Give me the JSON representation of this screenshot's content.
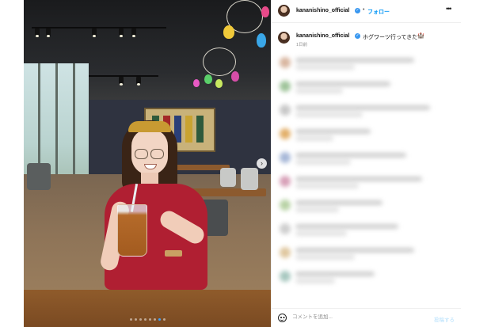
{
  "header": {
    "username": "kananishino_official",
    "verified_icon": "verified-badge-icon",
    "separator": "•",
    "follow_label": "フォロー",
    "more_icon": "more-options-icon",
    "more_glyph": "•••"
  },
  "caption": {
    "username": "kananishino_official",
    "text": "ホグワーツ行ってきた",
    "emoji": "🏰",
    "time": "1日前"
  },
  "media": {
    "next_icon": "chevron-right-icon",
    "next_glyph": "›",
    "carousel_count": 8,
    "carousel_active_index": 6,
    "colors": {
      "active_dot": "#3aa3ff",
      "shirt": "#b01f32"
    }
  },
  "comment_box": {
    "emoji_icon": "emoji-smiley-icon",
    "placeholder": "コメントを追加...",
    "post_label": "投稿する"
  },
  "colors": {
    "link_blue": "#0095f6",
    "verified_blue": "#3897f0",
    "post_disabled": "#b2dffc"
  }
}
